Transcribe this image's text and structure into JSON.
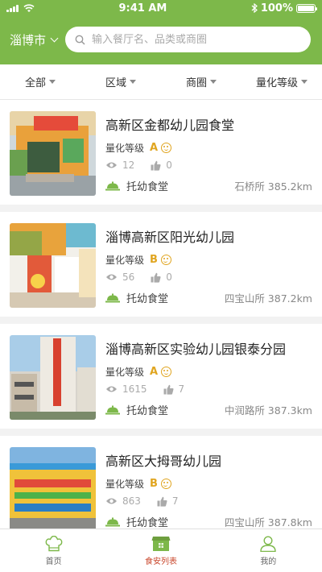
{
  "status": {
    "time": "9:41 AM",
    "battery": "100%",
    "battery_level": 1.0
  },
  "header": {
    "city": "淄博市",
    "search_placeholder": "输入餐厅名、品类或商圈"
  },
  "filters": [
    {
      "label": "全部"
    },
    {
      "label": "区域"
    },
    {
      "label": "商圈"
    },
    {
      "label": "量化等级"
    }
  ],
  "list": {
    "grade_label": "量化等级",
    "items": [
      {
        "name": "高新区金都幼儿园食堂",
        "grade": "A",
        "views": "12",
        "likes": "0",
        "type": "托幼食堂",
        "location": "石桥所 385.2km"
      },
      {
        "name": "淄博高新区阳光幼儿园",
        "grade": "B",
        "views": "56",
        "likes": "0",
        "type": "托幼食堂",
        "location": "四宝山所 387.2km"
      },
      {
        "name": "淄博高新区实验幼儿园银泰分园",
        "grade": "A",
        "views": "1615",
        "likes": "7",
        "type": "托幼食堂",
        "location": "中润路所 387.3km"
      },
      {
        "name": "高新区大拇哥幼儿园",
        "grade": "B",
        "views": "863",
        "likes": "7",
        "type": "托幼食堂",
        "location": "四宝山所 387.8km"
      }
    ]
  },
  "tabbar": [
    {
      "label": "首页",
      "icon": "chef-hat-icon"
    },
    {
      "label": "食安列表",
      "icon": "storefront-icon",
      "active": true
    },
    {
      "label": "我的",
      "icon": "user-icon"
    }
  ],
  "colors": {
    "brand_green": "#7db84a",
    "grade_gold": "#e0a520",
    "active_tab": "#c9472c"
  }
}
